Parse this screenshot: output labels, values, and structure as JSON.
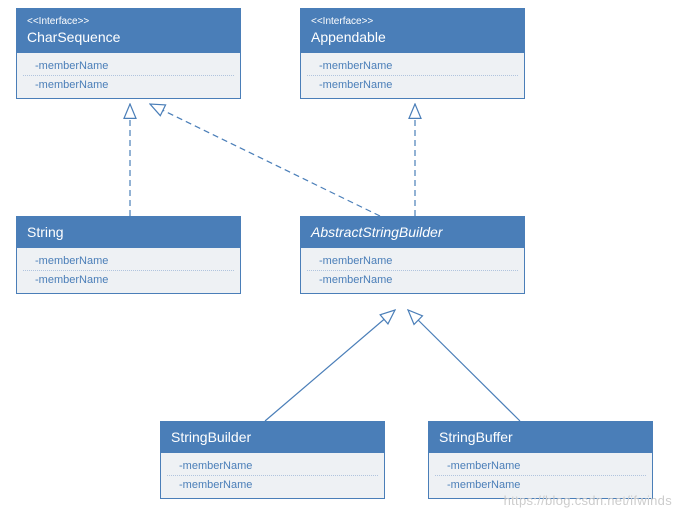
{
  "stereotype_label": "<<Interface>>",
  "member_placeholder": "-memberName",
  "classes": {
    "charsequence": {
      "name": "CharSequence"
    },
    "appendable": {
      "name": "Appendable"
    },
    "string": {
      "name": "String"
    },
    "abstractstringbuilder": {
      "name": "AbstractStringBuilder"
    },
    "stringbuilder": {
      "name": "StringBuilder"
    },
    "stringbuffer": {
      "name": "StringBuffer"
    }
  },
  "watermark": "https://blog.csdn.net/ifwinds",
  "chart_data": {
    "type": "uml-class-diagram",
    "nodes": [
      {
        "id": "CharSequence",
        "kind": "interface"
      },
      {
        "id": "Appendable",
        "kind": "interface"
      },
      {
        "id": "String",
        "kind": "class"
      },
      {
        "id": "AbstractStringBuilder",
        "kind": "abstract-class"
      },
      {
        "id": "StringBuilder",
        "kind": "class"
      },
      {
        "id": "StringBuffer",
        "kind": "class"
      }
    ],
    "edges": [
      {
        "from": "String",
        "to": "CharSequence",
        "type": "realization"
      },
      {
        "from": "AbstractStringBuilder",
        "to": "CharSequence",
        "type": "realization"
      },
      {
        "from": "AbstractStringBuilder",
        "to": "Appendable",
        "type": "realization"
      },
      {
        "from": "StringBuilder",
        "to": "AbstractStringBuilder",
        "type": "generalization"
      },
      {
        "from": "StringBuffer",
        "to": "AbstractStringBuilder",
        "type": "generalization"
      }
    ]
  }
}
